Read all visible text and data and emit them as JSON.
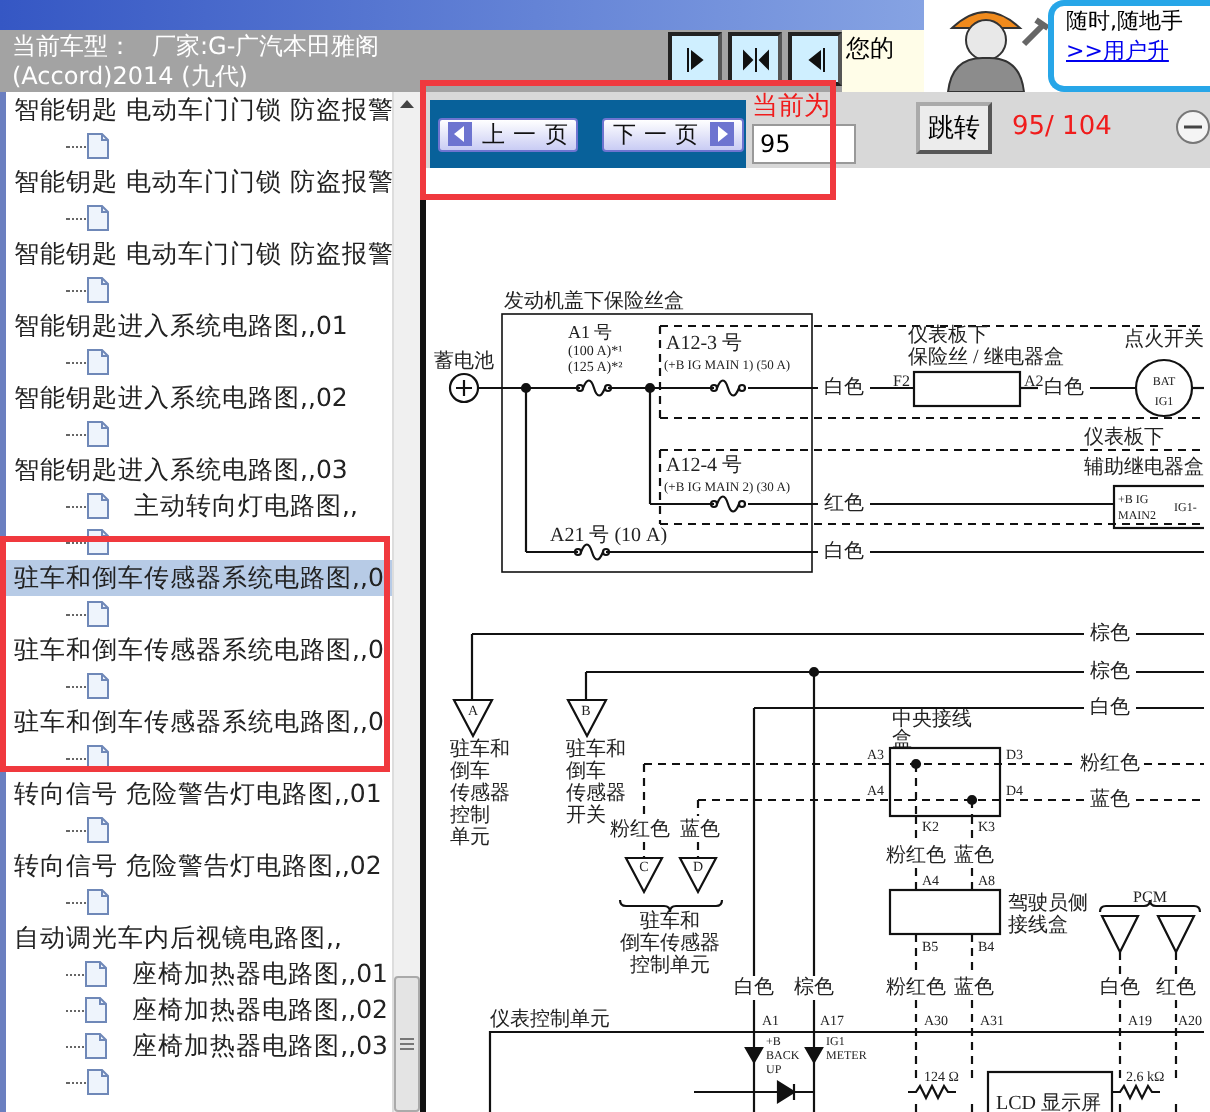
{
  "header": {
    "vehicle_label": "当前车型：",
    "vehicle_maker": "厂家:G-广汽本田雅阁",
    "vehicle_model": "(Accord)2014 (九代)",
    "notice": "您的",
    "ad_text": "随时,随地手",
    "ad_link": ">>用户升"
  },
  "tree": {
    "rows": [
      {
        "kind": "label",
        "text": "智能钥匙 电动车门门锁 防盗报警",
        "selected": false
      },
      {
        "kind": "leaf",
        "selected": false
      },
      {
        "kind": "label",
        "text": "智能钥匙 电动车门门锁 防盗报警",
        "selected": false
      },
      {
        "kind": "leaf",
        "selected": false
      },
      {
        "kind": "label",
        "text": "智能钥匙 电动车门门锁 防盗报警",
        "selected": false
      },
      {
        "kind": "leaf",
        "selected": false
      },
      {
        "kind": "label",
        "text": "智能钥匙进入系统电路图,,01",
        "selected": false
      },
      {
        "kind": "leaf",
        "selected": false
      },
      {
        "kind": "label",
        "text": "智能钥匙进入系统电路图,,02",
        "selected": false
      },
      {
        "kind": "leaf",
        "selected": false
      },
      {
        "kind": "label",
        "text": "智能钥匙进入系统电路图,,03",
        "selected": false
      },
      {
        "kind": "leaf",
        "text": "主动转向灯电路图,,",
        "selected": false
      },
      {
        "kind": "leaf",
        "selected": false
      },
      {
        "kind": "label",
        "text": "驻车和倒车传感器系统电路图,,0",
        "selected": true
      },
      {
        "kind": "leaf",
        "selected": false
      },
      {
        "kind": "label",
        "text": "驻车和倒车传感器系统电路图,,0",
        "selected": false
      },
      {
        "kind": "leaf",
        "selected": false
      },
      {
        "kind": "label",
        "text": "驻车和倒车传感器系统电路图,,0",
        "selected": false
      },
      {
        "kind": "leaf",
        "selected": false
      },
      {
        "kind": "label",
        "text": "转向信号 危险警告灯电路图,,01",
        "selected": false
      },
      {
        "kind": "leaf",
        "selected": false
      },
      {
        "kind": "label",
        "text": "转向信号 危险警告灯电路图,,02",
        "selected": false
      },
      {
        "kind": "leaf",
        "selected": false
      },
      {
        "kind": "label",
        "text": "自动调光车内后视镜电路图,,",
        "selected": false
      },
      {
        "kind": "leaf",
        "text": "座椅加热器电路图,,01",
        "selected": false
      },
      {
        "kind": "leaf",
        "text": "座椅加热器电路图,,02",
        "selected": false
      },
      {
        "kind": "leaf",
        "text": "座椅加热器电路图,,03",
        "selected": false
      },
      {
        "kind": "leaf",
        "selected": false
      }
    ]
  },
  "pager": {
    "prev": "上 一 页",
    "next": "下 一 页",
    "current_label": "当前为",
    "page_value": "95",
    "jump": "跳转",
    "count": "95/ 104"
  },
  "diagram": {
    "labels": [
      "发动机盖下保险丝盒",
      "蓄电池",
      "A1 号",
      "(100 A)*¹",
      "(125 A)*²",
      "A12-3 号",
      "(+B IG MAIN 1) (50 A)",
      "白色",
      "仪表板下",
      "保险丝 / 继电器盒",
      "F2",
      "A2",
      "白色",
      "点火开关",
      "BAT",
      "IG1",
      "A12-4 号",
      "(+B IG MAIN 2) (30 A)",
      "仪表板下",
      "辅助继电器盒",
      "红色",
      "+B IG",
      "MAIN2",
      "IG1-",
      "A21 号 (10 A)",
      "白色",
      "棕色",
      "棕色",
      "A",
      "B",
      "白色",
      "驻车和",
      "倒车",
      "传感器",
      "控制",
      "单元",
      "驻车和",
      "倒车",
      "传感器",
      "开关",
      "中央接线",
      "盒",
      "A3",
      "D3",
      "粉红色",
      "A4",
      "D4",
      "蓝色",
      "粉红色",
      "蓝色",
      "K2",
      "K3",
      "C",
      "D",
      "粉红色",
      "蓝色",
      "A4",
      "A8",
      "驾驶员侧",
      "接线盒",
      "PCM",
      "驻车和",
      "倒车传感器",
      "控制单元",
      "B5",
      "B4",
      "白色",
      "棕色",
      "粉红色",
      "蓝色",
      "白色",
      "红色",
      "仪表控制单元",
      "A1",
      "A17",
      "A30",
      "A31",
      "A19",
      "A20",
      "+B",
      "BACK",
      "UP",
      "IG1",
      "METER",
      "124 Ω",
      "2.6 kΩ",
      "LCD 显示屏"
    ]
  }
}
